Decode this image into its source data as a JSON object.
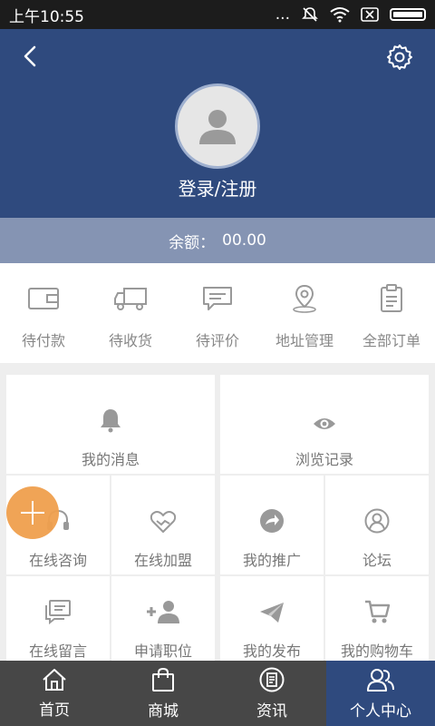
{
  "status_bar": {
    "time": "上午10:55",
    "signal": "...",
    "icons": [
      "mute-icon",
      "wifi-icon",
      "sim-icon",
      "battery-icon"
    ]
  },
  "header": {
    "login_label": "登录/注册",
    "icons": [
      "back-icon",
      "gear-icon",
      "avatar-user-icon"
    ]
  },
  "balance": {
    "label": "余额：",
    "value": "00.00"
  },
  "orders": [
    {
      "label": "待付款",
      "icon": "wallet-icon"
    },
    {
      "label": "待收货",
      "icon": "truck-icon"
    },
    {
      "label": "待评价",
      "icon": "comment-icon"
    },
    {
      "label": "地址管理",
      "icon": "location-icon"
    },
    {
      "label": "全部订单",
      "icon": "clipboard-icon"
    }
  ],
  "grid": {
    "top": [
      {
        "label": "我的消息",
        "icon": "bell-icon"
      },
      {
        "label": "浏览记录",
        "icon": "eye-icon"
      }
    ],
    "middle": [
      {
        "label": "在线咨询",
        "icon": "headset-icon"
      },
      {
        "label": "在线加盟",
        "icon": "handshake-icon"
      },
      {
        "label": "我的推广",
        "icon": "share-arrow-icon"
      },
      {
        "label": "论坛",
        "icon": "user-circle-icon"
      }
    ],
    "bottom": [
      {
        "label": "在线留言",
        "icon": "message-icon"
      },
      {
        "label": "申请职位",
        "icon": "add-user-icon"
      },
      {
        "label": "我的发布",
        "icon": "paper-plane-icon"
      },
      {
        "label": "我的购物车",
        "icon": "cart-icon"
      }
    ]
  },
  "fab": {
    "icon": "plus-icon",
    "color": "#f0a04e"
  },
  "tabbar": {
    "active_index": 3,
    "tabs": [
      {
        "label": "首页",
        "icon": "home-icon"
      },
      {
        "label": "商城",
        "icon": "bag-icon"
      },
      {
        "label": "资讯",
        "icon": "news-icon"
      },
      {
        "label": "个人中心",
        "icon": "people-icon"
      }
    ]
  },
  "colors": {
    "primary": "#2f4a7e",
    "balance_bar": "#8594b3",
    "tabbar": "#474747",
    "accent": "#f0a04e"
  }
}
